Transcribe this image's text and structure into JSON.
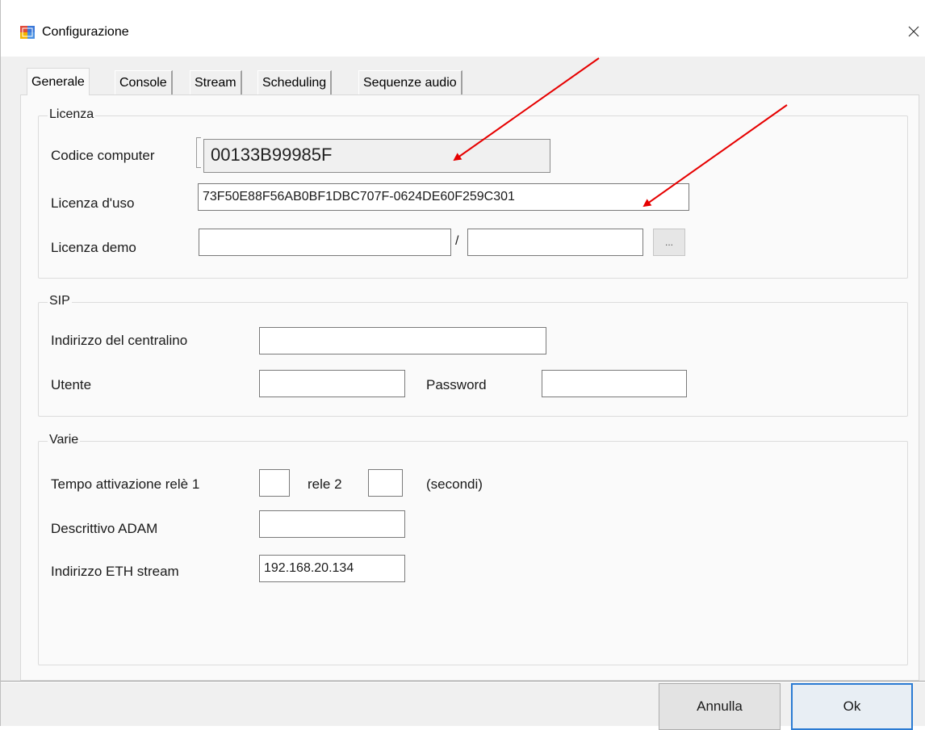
{
  "window": {
    "title": "Configurazione",
    "icon": "app-window-icon",
    "close_icon": "close-icon"
  },
  "tabs": [
    {
      "label": "Generale",
      "active": true
    },
    {
      "label": "Console",
      "active": false
    },
    {
      "label": "Stream",
      "active": false
    },
    {
      "label": "Scheduling",
      "active": false
    },
    {
      "label": "Sequenze audio",
      "active": false
    }
  ],
  "licenza": {
    "group_title": "Licenza",
    "codice_computer_label": "Codice computer",
    "codice_computer_value": "00133B99985F",
    "licenza_uso_label": "Licenza d'uso",
    "licenza_uso_value": "73F50E88F56AB0BF1DBC707F-0624DE60F259C301",
    "licenza_demo_label": "Licenza demo",
    "licenza_demo_value_1": "",
    "licenza_demo_separator": "/",
    "licenza_demo_value_2": "",
    "browse_button_label": "..."
  },
  "sip": {
    "group_title": "SIP",
    "indirizzo_label": "Indirizzo del centralino",
    "indirizzo_value": "",
    "utente_label": "Utente",
    "utente_value": "",
    "password_label": "Password",
    "password_value": ""
  },
  "varie": {
    "group_title": "Varie",
    "tempo_label": "Tempo attivazione relè 1",
    "rele1_value": "",
    "rele2_label": "rele 2",
    "rele2_value": "",
    "secondi_label": "(secondi)",
    "adam_label": "Descrittivo ADAM",
    "adam_value": "",
    "eth_label": "Indirizzo ETH stream",
    "eth_value": "192.168.20.134"
  },
  "buttons": {
    "annulla": "Annulla",
    "ok": "Ok"
  },
  "colors": {
    "annotation_arrow": "#e60000",
    "ok_border": "#2b7bd3"
  }
}
